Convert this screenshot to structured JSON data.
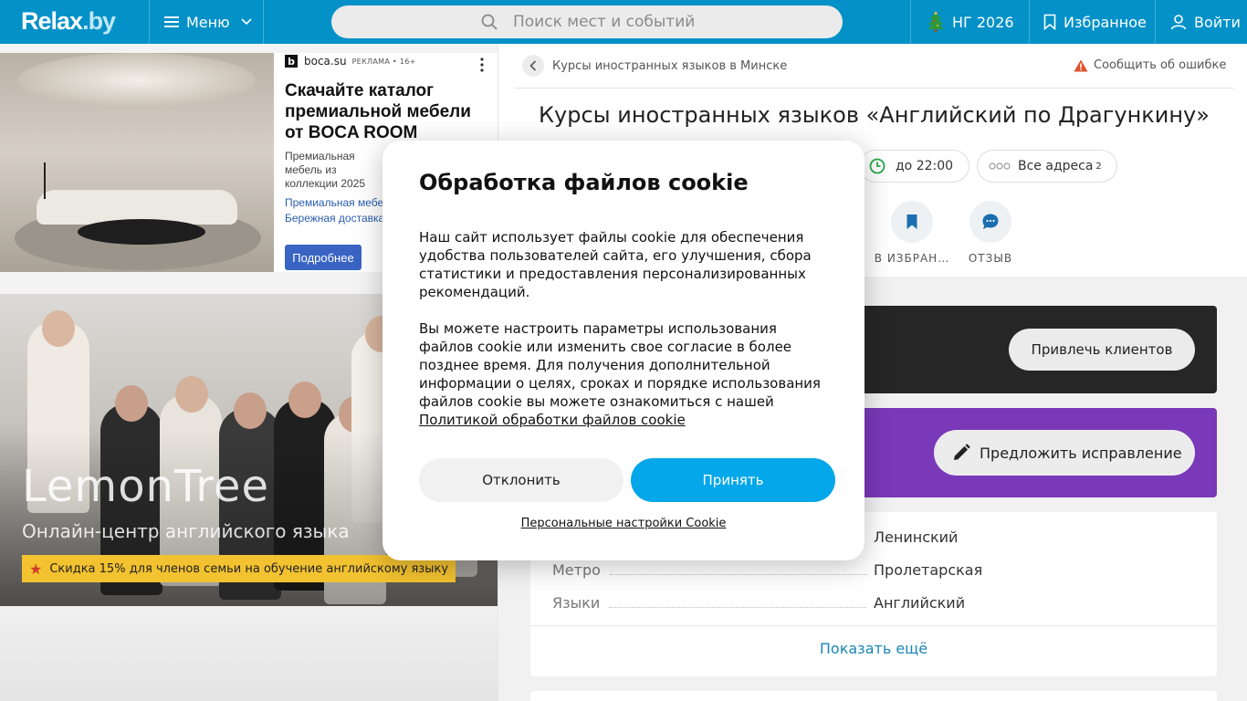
{
  "header": {
    "logo": "Relax",
    "logo_suffix": ".by",
    "menu_label": "Меню",
    "search_placeholder": "Поиск мест и событий",
    "ng_label": "НГ 2026",
    "favorites_label": "Избранное",
    "login_label": "Войти",
    "colors": {
      "bar": "#0391c8"
    }
  },
  "ad": {
    "source": "boca.su",
    "source_badge": "b",
    "tag": "РЕКЛАМА • 16+",
    "title": "Скачайте каталог премиальной мебели от BOCA ROOM",
    "description": "Премиальная мебель из коллекции 2025 под ваш интерьер!",
    "links": [
      "Премиальная мебель",
      "Бережная доставка"
    ],
    "button": "Подробнее"
  },
  "promo": {
    "title": "LemonTree",
    "subtitle": "Онлайн-центр английского языка",
    "badge": "Скидка 15% для членов семьи на обучение английскому языку"
  },
  "main": {
    "breadcrumb": "Курсы иностранных языков в Минске",
    "report_label": "Сообщить об ошибке",
    "title": "Курсы иностранных языков «Английский по Драгункину»",
    "hours_chip": "до 22:00",
    "addresses_chip": "Все адреса",
    "addresses_count": "2",
    "actions": {
      "favorite": "В ИЗБРАН…",
      "review": "ОТЗЫВ"
    },
    "attract_button": "Привлечь клиентов",
    "suggest_button": "Предложить исправление",
    "info": [
      {
        "key": "",
        "value": "Ленинский"
      },
      {
        "key": "Метро",
        "value": "Пролетарская"
      },
      {
        "key": "Языки",
        "value": "Английский"
      }
    ],
    "show_more": "Показать ещё",
    "colors": {
      "purple": "#7a39b8",
      "dark": "#262626"
    }
  },
  "cookie": {
    "title": "Обработка файлов cookie",
    "paragraph1": "Наш сайт использует файлы cookie для обеспечения удобства пользователей сайта, его улучшения, сбора статистики и предоставления персонализированных рекомендаций.",
    "paragraph2": "Вы можете настроить параметры использования файлов cookie или изменить свое согласие в более позднее время. Для получения дополнительной информации о целях, сроках и порядке использования файлов cookie вы можете ознакомиться с нашей",
    "policy_link": "Политикой обработки файлов cookie",
    "decline": "Отклонить",
    "accept": "Принять",
    "settings": "Персональные настройки Cookie",
    "colors": {
      "accept": "#04a7e9"
    }
  }
}
